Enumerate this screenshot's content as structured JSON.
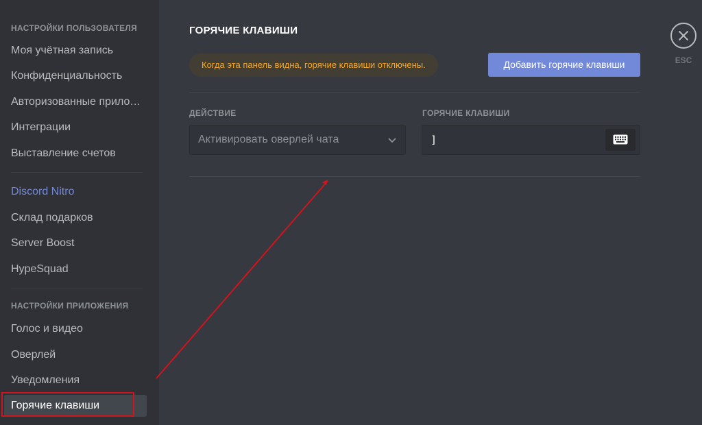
{
  "sidebar": {
    "user_settings_header": "НАСТРОЙКИ ПОЛЬЗОВАТЕЛЯ",
    "user_items": [
      {
        "label": "Моя учётная запись"
      },
      {
        "label": "Конфиденциальность"
      },
      {
        "label": "Авторизованные приложения"
      },
      {
        "label": "Интеграции"
      },
      {
        "label": "Выставление счетов"
      }
    ],
    "nitro_items": [
      {
        "label": "Discord Nitro"
      },
      {
        "label": "Склад подарков"
      },
      {
        "label": "Server Boost"
      },
      {
        "label": "HypeSquad"
      }
    ],
    "app_settings_header": "НАСТРОЙКИ ПРИЛОЖЕНИЯ",
    "app_items": [
      {
        "label": "Голос и видео"
      },
      {
        "label": "Оверлей"
      },
      {
        "label": "Уведомления"
      },
      {
        "label": "Горячие клавиши"
      }
    ],
    "selected": "Горячие клавиши",
    "accent_color": "#7289da"
  },
  "main": {
    "title": "ГОРЯЧИЕ КЛАВИШИ",
    "notice": "Когда эта панель видна, горячие клавиши отключены.",
    "notice_color": "#faa61a",
    "add_button": "Добавить горячие клавиши",
    "action_label": "ДЕЙСТВИЕ",
    "keybind_label": "ГОРЯЧИЕ КЛАВИШИ",
    "action_value": "Активировать оверлей чата",
    "keybind_value": "]",
    "keyboard_icon": "keyboard-icon",
    "dropdown_icon": "chevron-down-icon"
  },
  "close": {
    "icon": "close-icon",
    "label": "ESC"
  },
  "annotation": {
    "color": "#d1141d",
    "arrow_icon": "annotation-arrow"
  }
}
